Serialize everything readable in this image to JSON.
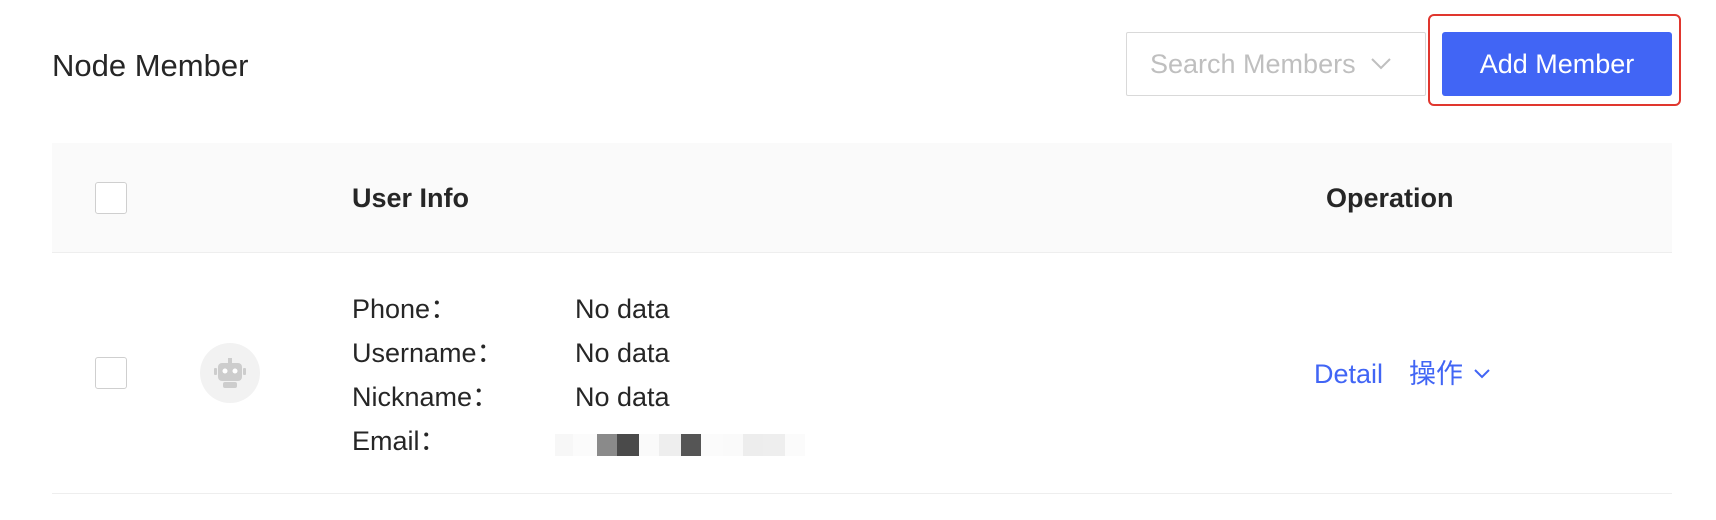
{
  "header": {
    "title": "Node Member",
    "search_placeholder": "Search Members",
    "add_button_label": "Add Member"
  },
  "table": {
    "columns": {
      "user_info": "User Info",
      "operation": "Operation"
    },
    "rows": [
      {
        "fields": [
          {
            "label": "Phone：",
            "value": "No data"
          },
          {
            "label": "Username：",
            "value": "No data"
          },
          {
            "label": "Nickname：",
            "value": "No data"
          },
          {
            "label": "Email：",
            "value": ""
          }
        ],
        "actions": {
          "detail": "Detail",
          "more": "操作"
        }
      }
    ]
  },
  "colors": {
    "primary": "#4165f5",
    "highlight_border": "#e0362e",
    "header_bg": "#fafafa",
    "text": "#262626",
    "placeholder": "#bfbfbf"
  },
  "icons": {
    "avatar": "robot-avatar-icon",
    "select_arrow": "chevron-down-icon"
  }
}
